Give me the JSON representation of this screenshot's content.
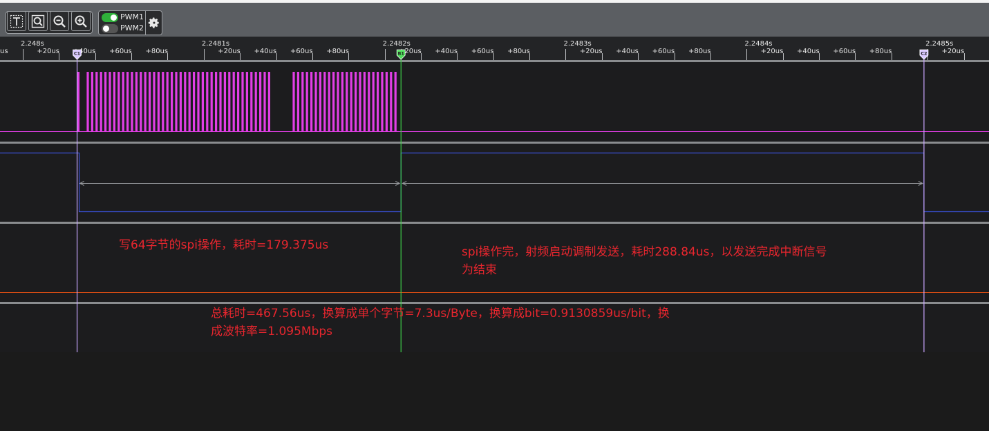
{
  "toolbar": {
    "tools": [
      {
        "name": "text-tool",
        "icon": "text-cursor-icon"
      },
      {
        "name": "zoom-fit",
        "icon": "zoom-box-icon"
      },
      {
        "name": "zoom-out",
        "icon": "zoom-out-icon"
      },
      {
        "name": "zoom-in",
        "icon": "zoom-in-icon"
      }
    ],
    "channels": [
      {
        "label": "PWM1",
        "enabled": true
      },
      {
        "label": "PWM2",
        "enabled": false
      }
    ],
    "settings_icon": "gear-icon"
  },
  "ruler": {
    "labels": [
      {
        "text": "us",
        "t": -3
      },
      {
        "text": "2.248s",
        "t": 0
      },
      {
        "text": "+20us",
        "t": 20
      },
      {
        "text": "+40us",
        "t": 40
      },
      {
        "text": "+60us",
        "t": 60
      },
      {
        "text": "+80us",
        "t": 80
      },
      {
        "text": "2.2481s",
        "t": 100
      },
      {
        "text": "+20us",
        "t": 120
      },
      {
        "text": "+40us",
        "t": 140
      },
      {
        "text": "+60us",
        "t": 160
      },
      {
        "text": "+80us",
        "t": 180
      },
      {
        "text": "2.2482s",
        "t": 200
      },
      {
        "text": "+20us",
        "t": 220
      },
      {
        "text": "+40us",
        "t": 240
      },
      {
        "text": "+60us",
        "t": 260
      },
      {
        "text": "+80us",
        "t": 280
      },
      {
        "text": "2.2483s",
        "t": 300
      },
      {
        "text": "+20us",
        "t": 320
      },
      {
        "text": "+40us",
        "t": 340
      },
      {
        "text": "+60us",
        "t": 360
      },
      {
        "text": "+80us",
        "t": 380
      },
      {
        "text": "2.2484s",
        "t": 400
      },
      {
        "text": "+20us",
        "t": 420
      },
      {
        "text": "+40us",
        "t": 440
      },
      {
        "text": "+60us",
        "t": 460
      },
      {
        "text": "+80us",
        "t": 480
      },
      {
        "text": "2.2485s",
        "t": 500
      },
      {
        "text": "+20us",
        "t": 520
      }
    ]
  },
  "cursors": [
    {
      "label": "C1",
      "t": 30,
      "color": "#c8a6ff"
    },
    {
      "label": "B1",
      "t": 209,
      "color": "#3ecf4a"
    },
    {
      "label": "C2",
      "t": 498,
      "color": "#c8a6ff"
    }
  ],
  "colors": {
    "pwm1": "#e23ee6",
    "pwm2": "#3a52d9",
    "ch3": "#d44b14",
    "annotation": "#e8262e",
    "cursor_b": "#3ecf4a",
    "cursor_c": "#c8a6ff"
  },
  "annotations": {
    "spi_write": "写64字节的spi操作，耗时=179.375us",
    "rf_line1": "spi操作完，射频启动调制发送，耗时288.84us，以发送完成中断信号",
    "rf_line2": "为结束",
    "total_line1": "总耗时=467.56us，换算成单个字节=7.3us/Byte，换算成bit=0.9130859us/bit，换",
    "total_line2": "成波特率=1.095Mbps"
  }
}
